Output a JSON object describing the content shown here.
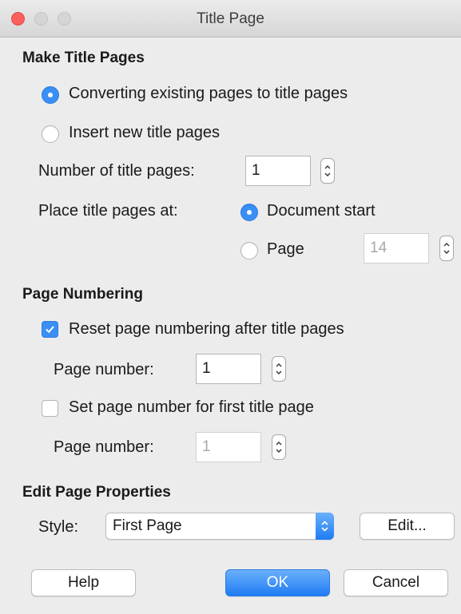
{
  "window": {
    "title": "Title Page"
  },
  "make_title_pages": {
    "heading": "Make Title Pages",
    "convert_label": "Converting existing pages to title pages",
    "insert_label": "Insert new title pages",
    "selected_mode": "convert",
    "number_label": "Number of title pages:",
    "number_value": "1",
    "place_label": "Place title pages at:",
    "doc_start_label": "Document start",
    "page_label": "Page",
    "page_value": "14",
    "selected_place": "document-start"
  },
  "page_numbering": {
    "heading": "Page Numbering",
    "reset_label": "Reset page numbering after title pages",
    "reset_checked": true,
    "reset_page_label": "Page number:",
    "reset_page_value": "1",
    "set_label": "Set page number for first title page",
    "set_checked": false,
    "set_page_label": "Page number:",
    "set_page_value": "1"
  },
  "edit_page_properties": {
    "heading": "Edit Page Properties",
    "style_label": "Style:",
    "style_value": "First Page",
    "edit_label": "Edit..."
  },
  "buttons": {
    "help": "Help",
    "ok": "OK",
    "cancel": "Cancel"
  },
  "colors": {
    "accent": "#3a8ff6",
    "close": "#fc605c",
    "background": "#ececec"
  }
}
